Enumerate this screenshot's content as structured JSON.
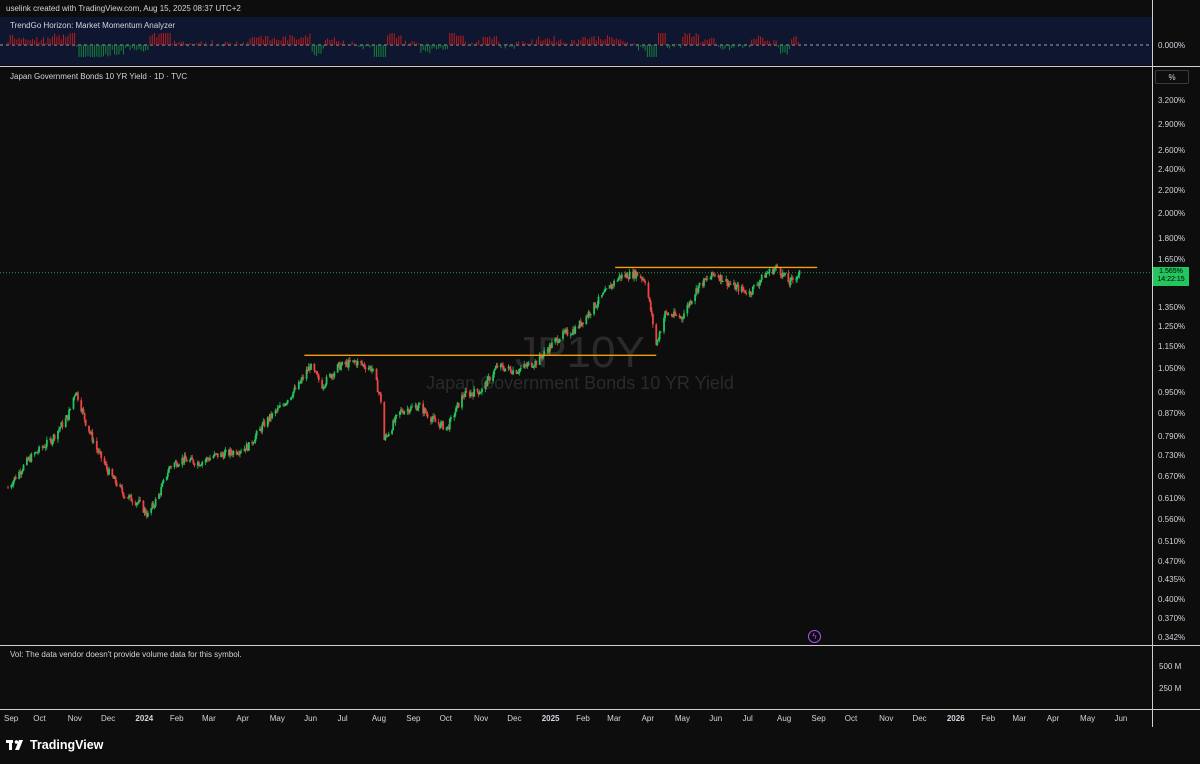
{
  "header": {
    "credit": "uselink created with TradingView.com, Aug 15, 2025 08:37 UTC+2"
  },
  "indicator": {
    "title": "TrendGo Horizon: Market Momentum Analyzer",
    "zero_label": "0.000%"
  },
  "main": {
    "title": "Japan Government Bonds 10 YR Yield · 1D · TVC",
    "watermark_symbol": "JP10Y",
    "watermark_name": "Japan Government Bonds 10 YR Yield",
    "scale_button": "%",
    "price_tag_value": "1.565%",
    "price_tag_timer": "14:22:15"
  },
  "volume": {
    "note": "Vol: The data vendor doesn't provide volume data for this symbol.",
    "ticks": [
      "500 M",
      "250 M"
    ]
  },
  "footer": {
    "brand": "TradingView"
  },
  "colors": {
    "up": "#22c55e",
    "down": "#ef4444",
    "resistance": "#f59e0b",
    "current_price_line": "#22c55e"
  },
  "chart_data": {
    "type": "candlestick",
    "symbol": "JP10Y",
    "timeframe": "1D",
    "y_scale": "log",
    "ylim": [
      0.342,
      3.4
    ],
    "y_ticks": [
      "3.200%",
      "2.900%",
      "2.600%",
      "2.400%",
      "2.200%",
      "2.000%",
      "1.800%",
      "1.650%",
      "1.350%",
      "1.250%",
      "1.150%",
      "1.050%",
      "0.950%",
      "0.870%",
      "0.790%",
      "0.730%",
      "0.670%",
      "0.610%",
      "0.560%",
      "0.510%",
      "0.470%",
      "0.435%",
      "0.400%",
      "0.370%",
      "0.342%"
    ],
    "x_ticks": [
      "Sep",
      "Oct",
      "Nov",
      "Dec",
      "2024",
      "Feb",
      "Mar",
      "Apr",
      "May",
      "Jun",
      "Jul",
      "Aug",
      "Sep",
      "Oct",
      "Nov",
      "Dec",
      "2025",
      "Feb",
      "Mar",
      "Apr",
      "May",
      "Jun",
      "Jul",
      "Aug",
      "Sep",
      "Oct",
      "Nov",
      "Dec",
      "2026",
      "Feb",
      "Mar",
      "Apr",
      "May",
      "Jun"
    ],
    "bold_x_ticks": [
      "2024",
      "2025",
      "2026"
    ],
    "price_path": [
      [
        "2023-09-01",
        0.64
      ],
      [
        "2023-09-20",
        0.72
      ],
      [
        "2023-10-10",
        0.78
      ],
      [
        "2023-10-25",
        0.86
      ],
      [
        "2023-11-01",
        0.96
      ],
      [
        "2023-11-10",
        0.84
      ],
      [
        "2023-11-20",
        0.75
      ],
      [
        "2023-12-01",
        0.68
      ],
      [
        "2023-12-15",
        0.62
      ],
      [
        "2023-12-28",
        0.6
      ],
      [
        "2024-01-05",
        0.57
      ],
      [
        "2024-01-15",
        0.62
      ],
      [
        "2024-01-25",
        0.7
      ],
      [
        "2024-02-05",
        0.72
      ],
      [
        "2024-02-20",
        0.71
      ],
      [
        "2024-03-05",
        0.73
      ],
      [
        "2024-03-20",
        0.74
      ],
      [
        "2024-04-05",
        0.76
      ],
      [
        "2024-04-20",
        0.84
      ],
      [
        "2024-05-05",
        0.9
      ],
      [
        "2024-05-20",
        0.98
      ],
      [
        "2024-05-30",
        1.06
      ],
      [
        "2024-06-10",
        0.98
      ],
      [
        "2024-06-25",
        1.06
      ],
      [
        "2024-07-10",
        1.08
      ],
      [
        "2024-07-25",
        1.05
      ],
      [
        "2024-08-02",
        0.92
      ],
      [
        "2024-08-05",
        0.78
      ],
      [
        "2024-08-20",
        0.88
      ],
      [
        "2024-09-05",
        0.9
      ],
      [
        "2024-09-20",
        0.84
      ],
      [
        "2024-10-01",
        0.82
      ],
      [
        "2024-10-15",
        0.94
      ],
      [
        "2024-11-01",
        0.96
      ],
      [
        "2024-11-15",
        1.06
      ],
      [
        "2024-12-01",
        1.04
      ],
      [
        "2024-12-20",
        1.08
      ],
      [
        "2025-01-10",
        1.2
      ],
      [
        "2025-01-25",
        1.24
      ],
      [
        "2025-02-10",
        1.36
      ],
      [
        "2025-02-25",
        1.48
      ],
      [
        "2025-03-05",
        1.54
      ],
      [
        "2025-03-20",
        1.56
      ],
      [
        "2025-03-28",
        1.52
      ],
      [
        "2025-04-07",
        1.16
      ],
      [
        "2025-04-15",
        1.32
      ],
      [
        "2025-04-30",
        1.3
      ],
      [
        "2025-05-15",
        1.48
      ],
      [
        "2025-05-30",
        1.56
      ],
      [
        "2025-06-15",
        1.48
      ],
      [
        "2025-06-30",
        1.44
      ],
      [
        "2025-07-15",
        1.56
      ],
      [
        "2025-07-25",
        1.6
      ],
      [
        "2025-08-05",
        1.5
      ],
      [
        "2025-08-14",
        1.565
      ]
    ],
    "resistance_lines": [
      {
        "from": "2024-05-25",
        "to": "2025-04-07",
        "value": 1.11
      },
      {
        "from": "2025-03-01",
        "to": "2025-08-30",
        "value": 1.6
      }
    ],
    "current_price": 1.565
  }
}
